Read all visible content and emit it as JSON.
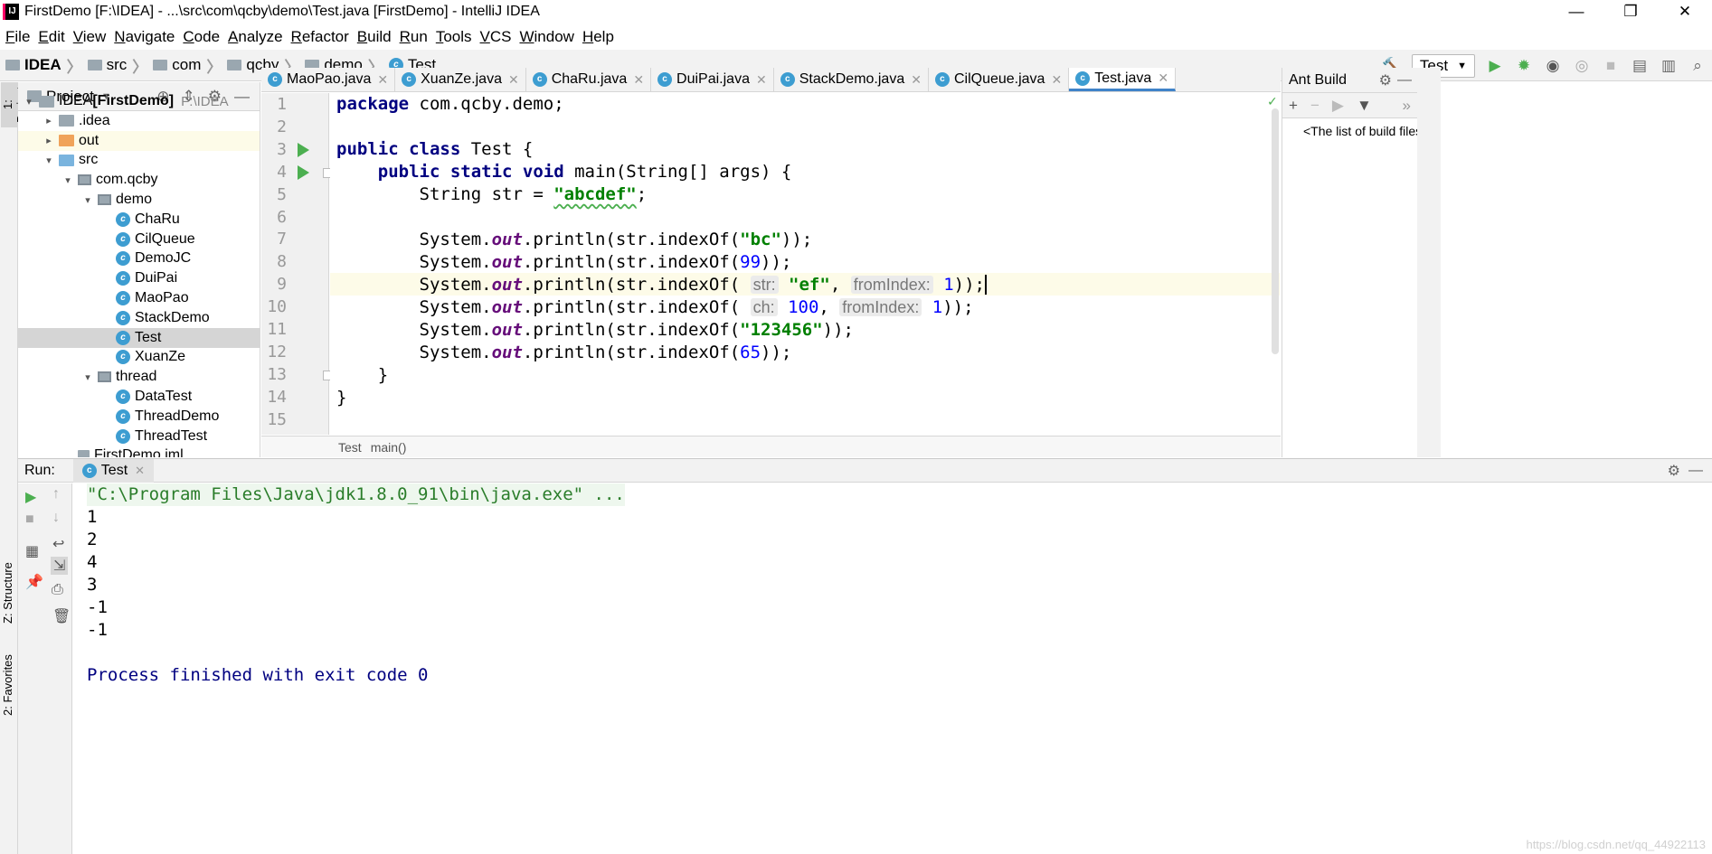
{
  "window": {
    "title": "FirstDemo [F:\\IDEA] - ...\\src\\com\\qcby\\demo\\Test.java [FirstDemo] - IntelliJ IDEA",
    "minimize": "—",
    "maximize": "❐",
    "close": "✕"
  },
  "menu": [
    "File",
    "Edit",
    "View",
    "Navigate",
    "Code",
    "Analyze",
    "Refactor",
    "Build",
    "Run",
    "Tools",
    "VCS",
    "Window",
    "Help"
  ],
  "breadcrumb": [
    "IDEA",
    "src",
    "com",
    "qcby",
    "demo",
    "Test"
  ],
  "run_config": "Test",
  "left_tabs": {
    "project": "1: Project",
    "structure": "Z: Structure",
    "favorites": "2: Favorites"
  },
  "project_panel": {
    "title": "Project",
    "tree": [
      {
        "label": "IDEA",
        "bold": "[FirstDemo]",
        "path": "F:\\IDEA",
        "type": "module",
        "arrow": "▾"
      },
      {
        "label": ".idea",
        "type": "folder",
        "arrow": "▸"
      },
      {
        "label": "out",
        "type": "folder-orange",
        "arrow": "▸"
      },
      {
        "label": "src",
        "type": "folder-blue",
        "arrow": "▾"
      },
      {
        "label": "com.qcby",
        "type": "package",
        "arrow": "▾"
      },
      {
        "label": "demo",
        "type": "package",
        "arrow": "▾"
      },
      {
        "label": "ChaRu",
        "type": "class"
      },
      {
        "label": "CilQueue",
        "type": "class"
      },
      {
        "label": "DemoJC",
        "type": "class"
      },
      {
        "label": "DuiPai",
        "type": "class"
      },
      {
        "label": "MaoPao",
        "type": "class"
      },
      {
        "label": "StackDemo",
        "type": "class"
      },
      {
        "label": "Test",
        "type": "class",
        "selected": true
      },
      {
        "label": "XuanZe",
        "type": "class"
      },
      {
        "label": "thread",
        "type": "package",
        "arrow": "▾"
      },
      {
        "label": "DataTest",
        "type": "class"
      },
      {
        "label": "ThreadDemo",
        "type": "class"
      },
      {
        "label": "ThreadTest",
        "type": "class"
      },
      {
        "label": "FirstDemo.iml",
        "type": "file"
      }
    ]
  },
  "tabs": [
    {
      "label": "MaoPao.java"
    },
    {
      "label": "XuanZe.java"
    },
    {
      "label": "ChaRu.java"
    },
    {
      "label": "DuiPai.java"
    },
    {
      "label": "StackDemo.java"
    },
    {
      "label": "CilQueue.java"
    },
    {
      "label": "Test.java",
      "active": true
    }
  ],
  "editor": {
    "line_numbers": [
      "1",
      "2",
      "3",
      "4",
      "5",
      "6",
      "7",
      "8",
      "9",
      "10",
      "11",
      "12",
      "13",
      "14",
      "15"
    ],
    "breadcrumb": [
      "Test",
      "main()"
    ]
  },
  "ant": {
    "title": "Ant Build",
    "message": "<The list of build files is empty>"
  },
  "run_panel": {
    "label": "Run:",
    "tab": "Test",
    "output": [
      "\"C:\\Program Files\\Java\\jdk1.8.0_91\\bin\\java.exe\" ...",
      "1",
      "2",
      "4",
      "3",
      "-1",
      "-1",
      "",
      "Process finished with exit code 0"
    ]
  },
  "watermark": "https://blog.csdn.net/qq_44922113"
}
